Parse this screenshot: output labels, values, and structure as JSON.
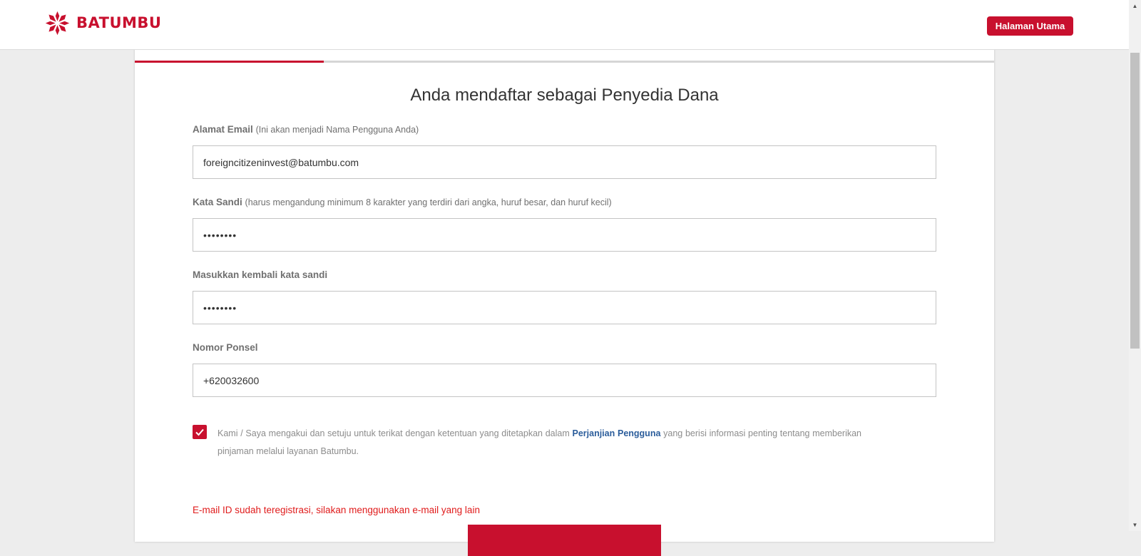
{
  "header": {
    "brand": "BATUMBU",
    "home_button": "Halaman Utama",
    "brand_color": "#c8102e"
  },
  "progress": {
    "fraction": 0.22
  },
  "form": {
    "title": "Anda mendaftar sebagai Penyedia Dana",
    "email": {
      "label": "Alamat Email",
      "hint": "(Ini akan menjadi Nama Pengguna Anda)",
      "value": "foreigncitizeninvest@batumbu.com"
    },
    "password": {
      "label": "Kata Sandi",
      "hint": "(harus mengandung minimum 8 karakter yang terdiri dari angka, huruf besar, dan huruf kecil)",
      "value": "12345678"
    },
    "confirm_password": {
      "label": "Masukkan kembali kata sandi",
      "value": "12345678"
    },
    "phone": {
      "label": "Nomor Ponsel",
      "value": "+620032600"
    },
    "agreement": {
      "checked": true,
      "text_before": "Kami / Saya mengakui dan setuju untuk terikat dengan ketentuan yang ditetapkan dalam ",
      "link_text": "Perjanjian Pengguna",
      "text_after": " yang berisi informasi penting tentang memberikan pinjaman melalui layanan Batumbu."
    },
    "error_message": "E-mail ID sudah teregistrasi, silakan menggunakan e-mail yang lain"
  },
  "icons": {
    "logo": "batumbu-logo-icon",
    "checkbox": "checkmark-icon",
    "scroll_up": "arrow-up-icon",
    "scroll_down": "arrow-down-icon"
  }
}
